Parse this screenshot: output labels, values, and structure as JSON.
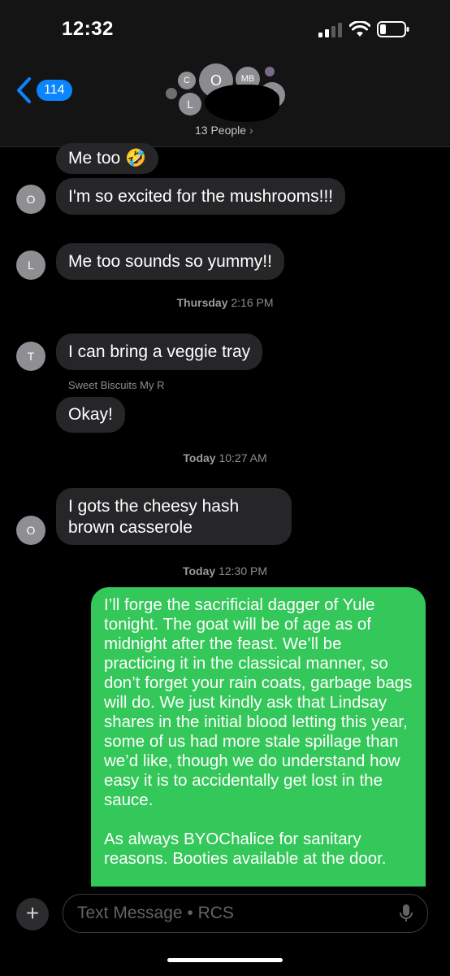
{
  "status_bar": {
    "time": "12:32"
  },
  "header": {
    "back_count": "114",
    "people_label": "13 People",
    "avatars": [
      "C",
      "O",
      "MB",
      "L",
      "T"
    ]
  },
  "messages": [
    {
      "sender": "",
      "text": "Me too 🤣"
    },
    {
      "sender": "O",
      "text": "I'm so excited for the mushrooms!!!"
    },
    {
      "sender": "L",
      "text": "Me too sounds so yummy!!"
    },
    {
      "sender": "T",
      "text": "I can bring a veggie tray"
    },
    {
      "sender": "",
      "text": "Okay!"
    },
    {
      "sender": "O",
      "text": "I gots the cheesy hash brown casserole"
    }
  ],
  "timestamps": [
    {
      "day": "Thursday",
      "time": "2:16 PM"
    },
    {
      "day": "Today",
      "time": "10:27 AM"
    },
    {
      "day": "Today",
      "time": "12:30 PM"
    }
  ],
  "sender_label": "Sweet Biscuits My R",
  "outgoing_message": "I’ll forge the sacrificial dagger of Yule tonight. The goat will be of age as of midnight after the feast. We’ll be practicing it in the classical manner, so don’t forget your rain coats, garbage bags will  do. We just kindly ask that Lindsay shares in the initial blood letting this year, some of us had more stale spillage than we’d like, though we do understand how easy it is to accidentally get lost in the sauce.\n\nAs always BYOChalice for sanitary reasons. Booties available at the door.",
  "compose": {
    "placeholder": "Text Message • RCS",
    "plus": "+"
  }
}
